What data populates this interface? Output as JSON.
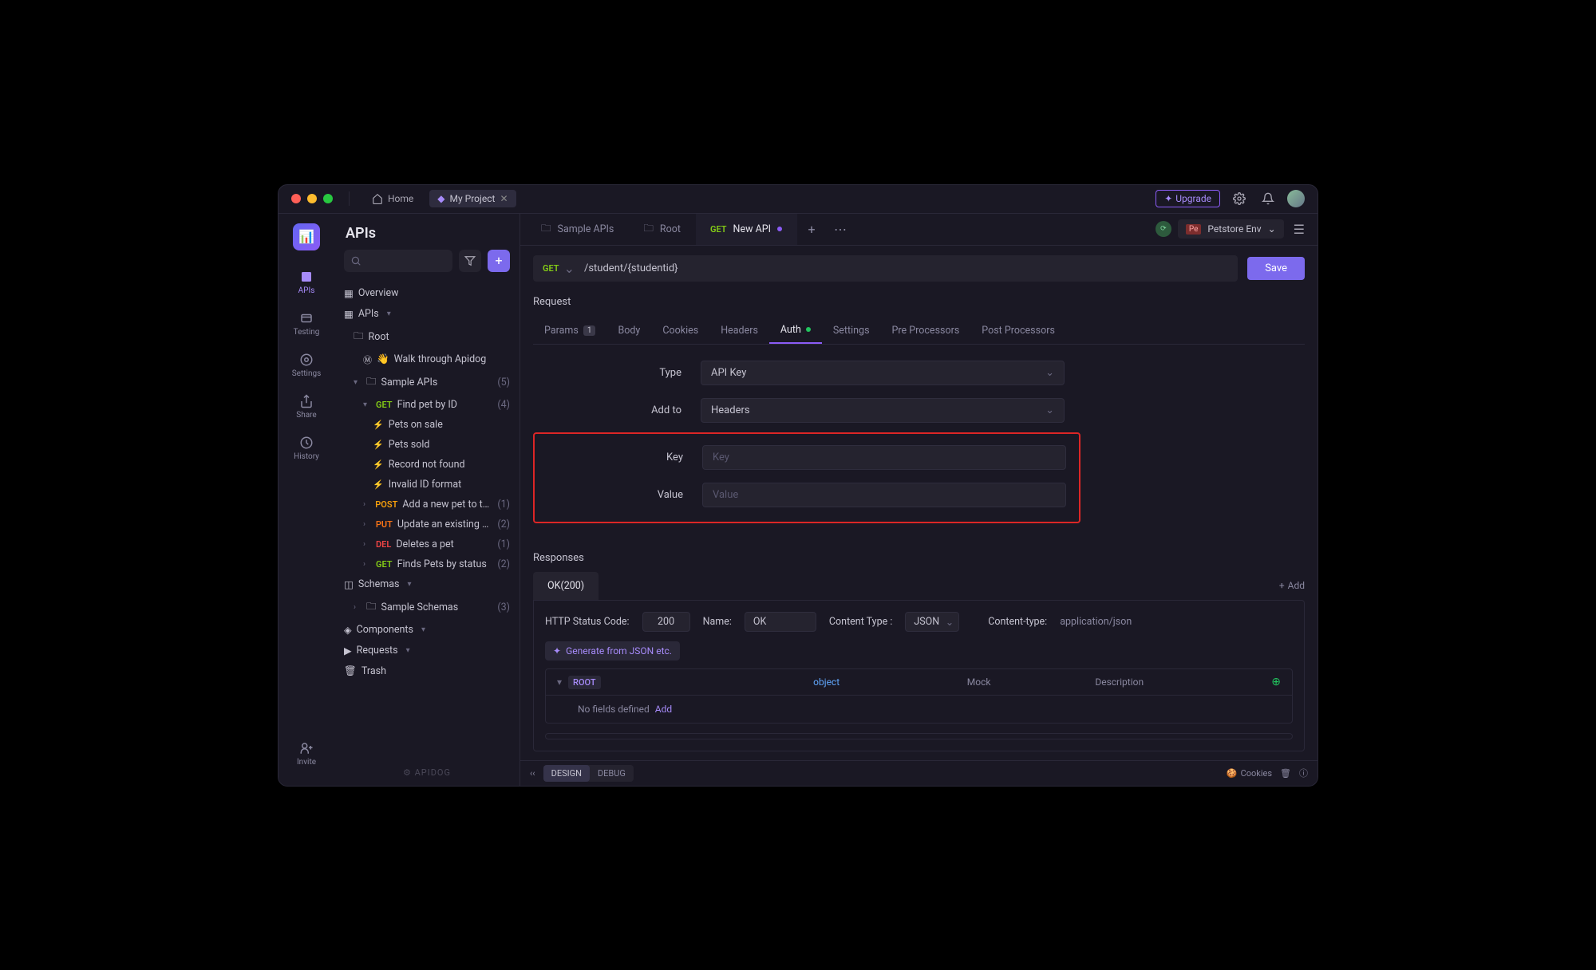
{
  "titlebar": {
    "home": "Home",
    "crumb": "My Project",
    "upgrade": "Upgrade"
  },
  "rail": {
    "apis": "APIs",
    "testing": "Testing",
    "settings": "Settings",
    "share": "Share",
    "history": "History",
    "invite": "Invite"
  },
  "sidebar": {
    "title": "APIs",
    "overview": "Overview",
    "apis_section": "APIs",
    "root": "Root",
    "walk": "Walk through Apidog",
    "sample_apis": "Sample APIs",
    "sample_apis_cnt": "(5)",
    "find_pet": "Find pet by ID",
    "find_pet_cnt": "(4)",
    "ex_on_sale": "Pets on sale",
    "ex_sold": "Pets sold",
    "ex_notfound": "Record not found",
    "ex_invalid": "Invalid ID format",
    "add_pet": "Add a new pet to the…",
    "add_pet_cnt": "(1)",
    "update_pet": "Update an existing p…",
    "update_pet_cnt": "(2)",
    "delete_pet": "Deletes a pet",
    "delete_pet_cnt": "(1)",
    "find_status": "Finds Pets by status",
    "find_status_cnt": "(2)",
    "schemas": "Schemas",
    "sample_schemas": "Sample Schemas",
    "sample_schemas_cnt": "(3)",
    "components": "Components",
    "requests": "Requests",
    "trash": "Trash",
    "footer": "⚙ APIDOG"
  },
  "tabs": {
    "t1": "Sample APIs",
    "t2": "Root",
    "t3_method": "GET",
    "t3_label": "New API",
    "env": "Petstore Env",
    "env_badge": "Pe"
  },
  "url": {
    "method": "GET",
    "path": "/student/{studentid}",
    "save": "Save"
  },
  "request": {
    "title": "Request",
    "tabs": {
      "params": "Params",
      "params_n": "1",
      "body": "Body",
      "cookies": "Cookies",
      "headers": "Headers",
      "auth": "Auth",
      "settings": "Settings",
      "pre": "Pre Processors",
      "post": "Post Processors"
    },
    "form": {
      "type_lbl": "Type",
      "type_val": "API Key",
      "addto_lbl": "Add to",
      "addto_val": "Headers",
      "key_lbl": "Key",
      "key_ph": "Key",
      "value_lbl": "Value",
      "value_ph": "Value"
    }
  },
  "responses": {
    "title": "Responses",
    "tab": "OK(200)",
    "add": "Add",
    "status_lbl": "HTTP Status Code:",
    "status_val": "200",
    "name_lbl": "Name:",
    "name_val": "OK",
    "ctype_lbl": "Content Type :",
    "ctype_val": "JSON",
    "cheader_lbl": "Content-type:",
    "cheader_val": "application/json",
    "generate": "Generate from JSON etc.",
    "root": "ROOT",
    "object": "object",
    "mock": "Mock",
    "description": "Description",
    "empty": "No fields defined",
    "empty_add": "Add"
  },
  "bottombar": {
    "design": "DESIGN",
    "debug": "DEBUG",
    "cookies": "Cookies"
  }
}
